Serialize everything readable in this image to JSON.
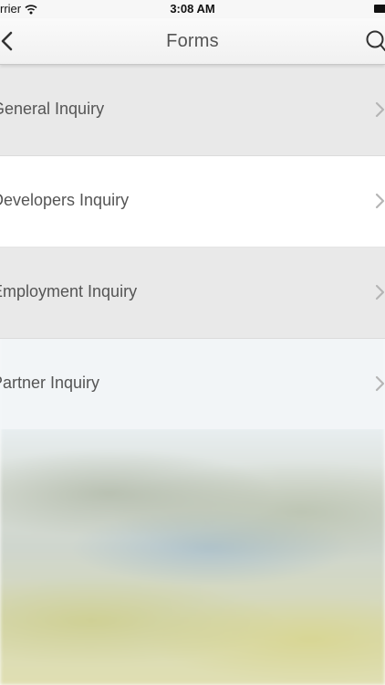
{
  "status_bar": {
    "carrier": "rrier",
    "time": "3:08 AM",
    "wifi_icon": "wifi-icon",
    "battery_icon": "battery-icon"
  },
  "nav": {
    "title": "Forms",
    "back_icon": "chevron-left-icon",
    "search_icon": "search-icon"
  },
  "forms": [
    {
      "label": "General Inquiry",
      "icon": "chevron-right-icon"
    },
    {
      "label": "Developers Inquiry",
      "icon": "chevron-right-icon"
    },
    {
      "label": "Employment Inquiry",
      "icon": "chevron-right-icon"
    },
    {
      "label": "Partner Inquiry",
      "icon": "chevron-right-icon"
    }
  ],
  "colors": {
    "nav_background": "#f4f4f4",
    "row_gray": "#e8e8e8",
    "row_white": "#ffffff",
    "text": "#555555",
    "chevron": "#b5b5b5"
  }
}
